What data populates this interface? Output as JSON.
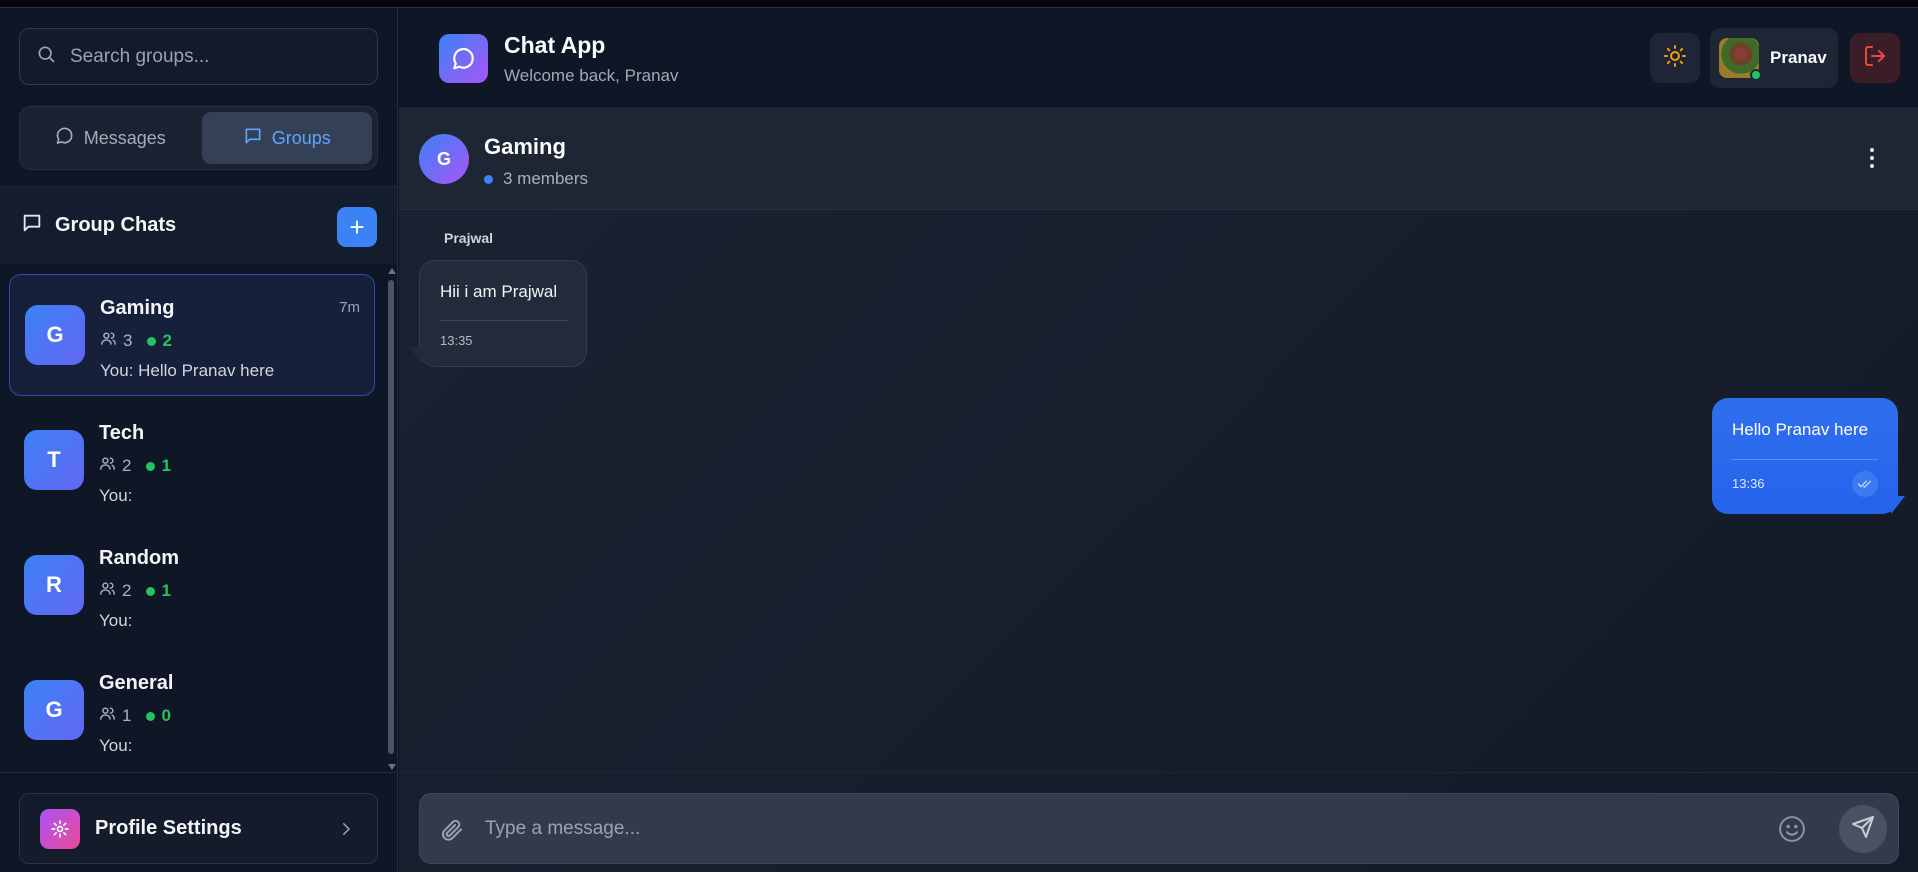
{
  "sidebar": {
    "search": {
      "placeholder": "Search groups..."
    },
    "tabs": [
      {
        "label": "Messages",
        "icon": "message-circle-icon",
        "active": false
      },
      {
        "label": "Groups",
        "icon": "message-square-icon",
        "active": true
      }
    ],
    "group_chats": {
      "title": "Group Chats",
      "add_label": "+"
    },
    "groups": [
      {
        "initial": "G",
        "name": "Gaming",
        "members": "3",
        "online": "2",
        "last_message": "You: Hello Pranav here",
        "time": "7m",
        "selected": true
      },
      {
        "initial": "T",
        "name": "Tech",
        "members": "2",
        "online": "1",
        "last_message": "You:",
        "time": "",
        "selected": false
      },
      {
        "initial": "R",
        "name": "Random",
        "members": "2",
        "online": "1",
        "last_message": "You:",
        "time": "",
        "selected": false
      },
      {
        "initial": "G",
        "name": "General",
        "members": "1",
        "online": "0",
        "last_message": "You:",
        "time": "",
        "selected": false
      }
    ],
    "profile_settings": {
      "label": "Profile Settings"
    }
  },
  "header": {
    "app_title": "Chat App",
    "welcome": "Welcome back, Pranav",
    "user_name": "Pranav"
  },
  "chat": {
    "avatar_initial": "G",
    "name": "Gaming",
    "members_text": "3 members",
    "messages": [
      {
        "sender": "Prajwal",
        "text": "Hii i am Prajwal",
        "time": "13:35",
        "outgoing": false
      },
      {
        "sender": "",
        "text": "Hello Pranav here",
        "time": "13:36",
        "outgoing": true
      }
    ]
  },
  "composer": {
    "placeholder": "Type a message..."
  },
  "colors": {
    "accent": "#3b82f6",
    "online": "#22c55e",
    "background": "#0d1424",
    "logout": "#ef4444",
    "theme_sun": "#f59e0b"
  }
}
